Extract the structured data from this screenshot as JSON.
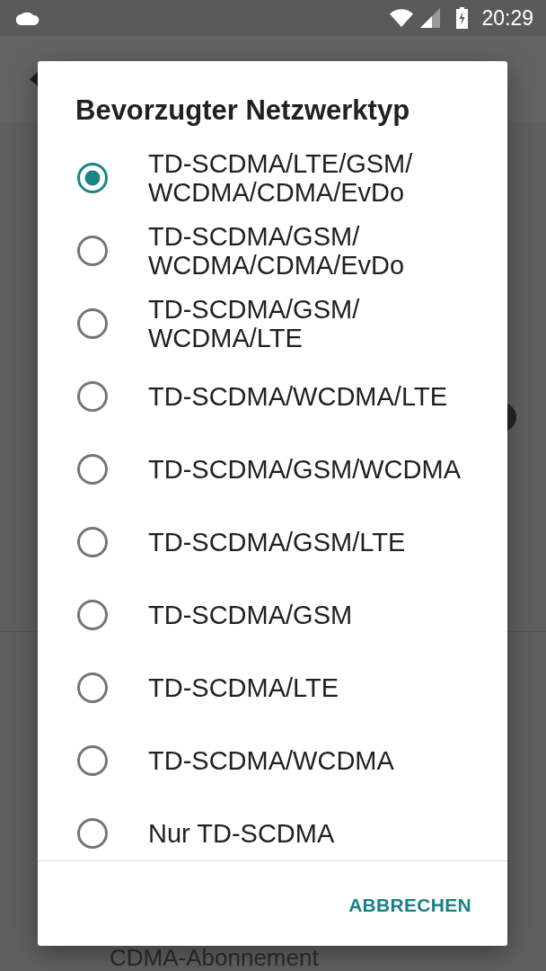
{
  "status_bar": {
    "time": "20:29"
  },
  "settings_list": {
    "partial_item": "CDMA-Abonnement"
  },
  "dialog": {
    "title": "Bevorzugter Netzwerktyp",
    "options": [
      {
        "label": "TD-SCDMA/LTE/GSM/WCDMA/CDMA/EvDo",
        "selected": true
      },
      {
        "label": "TD-SCDMA/GSM/WCDMA/CDMA/EvDo",
        "selected": false
      },
      {
        "label": "TD-SCDMA/GSM/WCDMA/LTE",
        "selected": false
      },
      {
        "label": "TD-SCDMA/WCDMA/LTE",
        "selected": false
      },
      {
        "label": "TD-SCDMA/GSM/WCDMA",
        "selected": false
      },
      {
        "label": "TD-SCDMA/GSM/LTE",
        "selected": false
      },
      {
        "label": "TD-SCDMA/GSM",
        "selected": false
      },
      {
        "label": "TD-SCDMA/LTE",
        "selected": false
      },
      {
        "label": "TD-SCDMA/WCDMA",
        "selected": false
      },
      {
        "label": "Nur TD-SCDMA",
        "selected": false
      }
    ],
    "buttons": [
      {
        "label": "ABBRECHEN"
      }
    ]
  }
}
